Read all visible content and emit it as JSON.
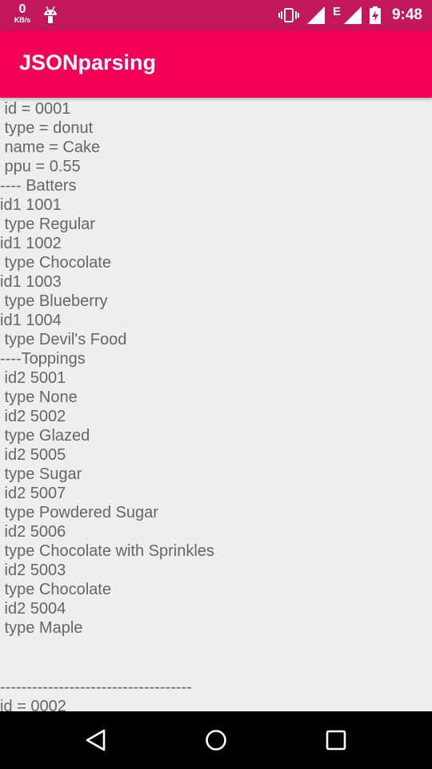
{
  "status_bar": {
    "speed_value": "0",
    "speed_unit": "KB/s",
    "network_label": "E",
    "time": "9:48",
    "icons": [
      "android-debug-icon",
      "vibrate-icon",
      "signal-icon",
      "signal-icon",
      "battery-charging-icon"
    ]
  },
  "app_bar": {
    "title": "JSONparsing",
    "color": "#f50057"
  },
  "content": {
    "lines": [
      " id = 0001",
      " type = donut",
      " name = Cake",
      " ppu = 0.55",
      "---- Batters",
      "id1 1001",
      " type Regular",
      "id1 1002",
      " type Chocolate",
      "id1 1003",
      " type Blueberry",
      "id1 1004",
      " type Devil's Food",
      "----Toppings",
      " id2 5001",
      " type None",
      " id2 5002",
      " type Glazed",
      " id2 5005",
      " type Sugar",
      " id2 5007",
      " type Powdered Sugar",
      " id2 5006",
      " type Chocolate with Sprinkles",
      " id2 5003",
      " type Chocolate",
      " id2 5004",
      " type Maple",
      "",
      "",
      "------------------------------------",
      "id = 0002"
    ]
  },
  "nav_bar": {
    "buttons": [
      "back-icon",
      "home-icon",
      "recents-icon"
    ]
  }
}
